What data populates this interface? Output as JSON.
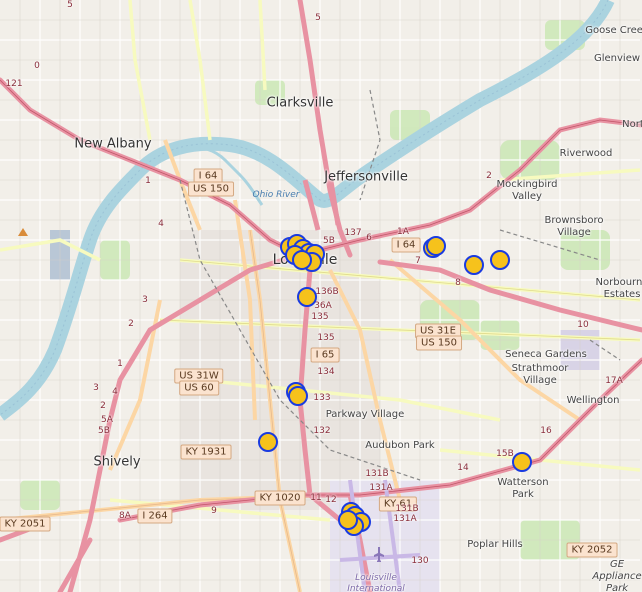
{
  "map": {
    "river": "Ohio River",
    "airport": "Louisville International",
    "cities": [
      "Clarksville",
      "Jeffersonville",
      "New Albany",
      "Louisville",
      "Shively"
    ],
    "neighborhoods": [
      "Goose Creek",
      "Glenview",
      "Riverwood",
      "Mockingbird Valley",
      "Brownsboro Village",
      "Norbourne Estates",
      "Seneca Gardens",
      "Strathmoor Village",
      "Wellington",
      "Parkway Village",
      "Audubon Park",
      "Watterson Park",
      "Poplar Hills",
      "GE Appliance Park",
      "Nort"
    ],
    "shields": [
      "I 64",
      "US 150",
      "I 64",
      "US 31E",
      "US 150",
      "I 65",
      "US 31W",
      "US 60",
      "KY 1931",
      "KY 1020",
      "I 264",
      "KY 61",
      "KY 2051",
      "KY 2052"
    ],
    "exits": [
      "121",
      "0",
      "5",
      "1",
      "4",
      "3",
      "2",
      "1",
      "2",
      "3",
      "4",
      "5A",
      "5B",
      "8A",
      "9",
      "137",
      "6",
      "5B",
      "1A",
      "2",
      "8",
      "10",
      "17A",
      "16",
      "15B",
      "14",
      "7",
      "136B",
      "36A",
      "135",
      "135",
      "134",
      "133",
      "132",
      "11",
      "12",
      "131B",
      "131A",
      "131B",
      "131A",
      "130",
      "5"
    ],
    "marker_count": 22
  }
}
